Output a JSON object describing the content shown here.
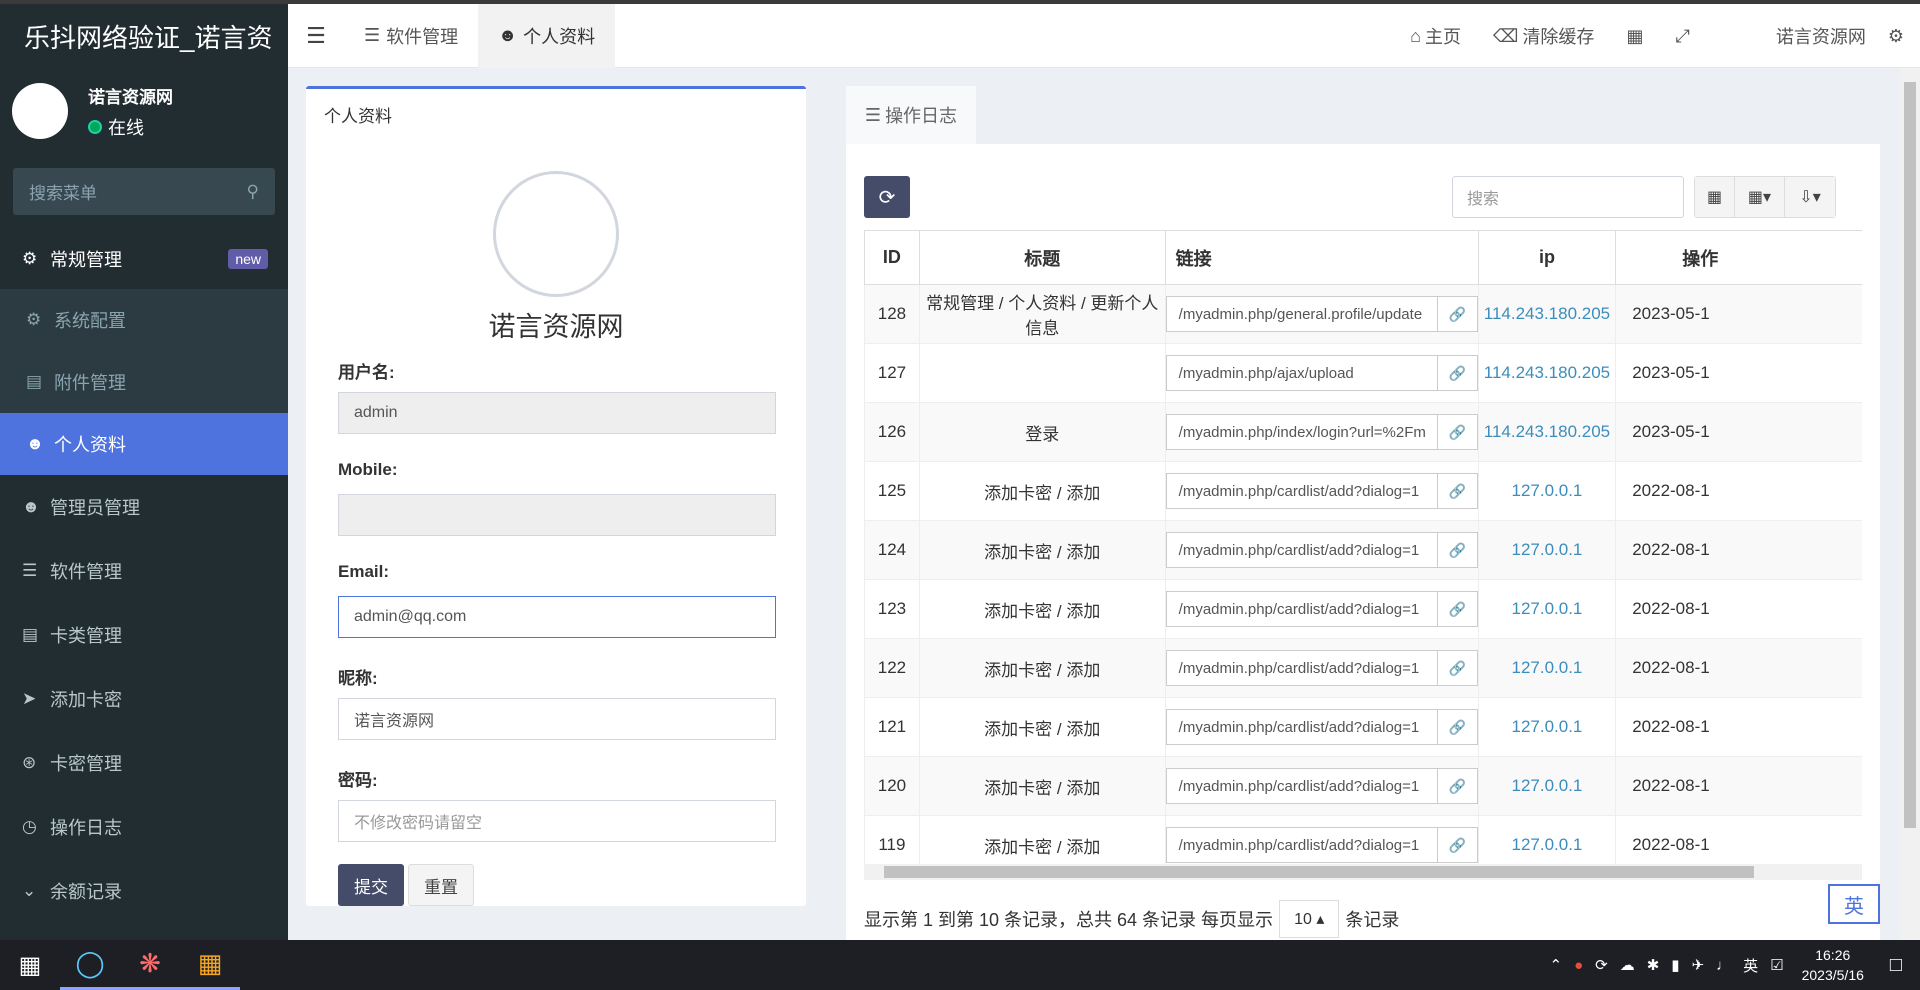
{
  "app": {
    "title": "乐抖网络验证_诺言资",
    "user_name": "诺言资源网",
    "status": "在线"
  },
  "sidebar": {
    "search_placeholder": "搜索菜单",
    "header": {
      "label": "常规管理",
      "badge": "new"
    },
    "submenu": [
      {
        "label": "系统配置",
        "icon": "gear-icon"
      },
      {
        "label": "附件管理",
        "icon": "file-image-icon"
      }
    ],
    "items": [
      {
        "label": "个人资料",
        "icon": "user-icon",
        "active": true
      },
      {
        "label": "管理员管理",
        "icon": "user-icon"
      },
      {
        "label": "软件管理",
        "icon": "list-icon"
      },
      {
        "label": "卡类管理",
        "icon": "tasks-icon"
      },
      {
        "label": "添加卡密",
        "icon": "paper-plane-icon"
      },
      {
        "label": "卡密管理",
        "icon": "rss-icon"
      },
      {
        "label": "操作日志",
        "icon": "clock-icon"
      },
      {
        "label": "余额记录",
        "icon": "chevron-down-icon"
      }
    ]
  },
  "navbar": {
    "tabs": [
      {
        "label": "软件管理",
        "icon": "list-icon"
      },
      {
        "label": "个人资料",
        "icon": "user-icon"
      }
    ],
    "home": "主页",
    "clear_cache": "清除缓存",
    "username": "诺言资源网"
  },
  "profile": {
    "panel_title": "个人资料",
    "display_name": "诺言资源网",
    "fields": {
      "username_label": "用户名:",
      "username_value": "admin",
      "mobile_label": "Mobile:",
      "mobile_value": "",
      "email_label": "Email:",
      "email_value": "admin@qq.com",
      "nickname_label": "昵称:",
      "nickname_value": "诺言资源网",
      "password_label": "密码:",
      "password_placeholder": "不修改密码请留空"
    },
    "submit": "提交",
    "reset": "重置"
  },
  "log": {
    "tab": "操作日志",
    "search_placeholder": "搜索",
    "columns": [
      "ID",
      "标题",
      "链接",
      "ip",
      "操作"
    ],
    "rows": [
      {
        "id": "128",
        "title": "常规管理 / 个人资料 / 更新个人信息",
        "url": "/myadmin.php/general.profile/update",
        "ip": "114.243.180.205",
        "time": "2023-05-1"
      },
      {
        "id": "127",
        "title": "",
        "url": "/myadmin.php/ajax/upload",
        "ip": "114.243.180.205",
        "time": "2023-05-1"
      },
      {
        "id": "126",
        "title": "登录",
        "url": "/myadmin.php/index/login?url=%2Fm",
        "ip": "114.243.180.205",
        "time": "2023-05-1"
      },
      {
        "id": "125",
        "title": "添加卡密 / 添加",
        "url": "/myadmin.php/cardlist/add?dialog=1",
        "ip": "127.0.0.1",
        "time": "2022-08-1"
      },
      {
        "id": "124",
        "title": "添加卡密 / 添加",
        "url": "/myadmin.php/cardlist/add?dialog=1",
        "ip": "127.0.0.1",
        "time": "2022-08-1"
      },
      {
        "id": "123",
        "title": "添加卡密 / 添加",
        "url": "/myadmin.php/cardlist/add?dialog=1",
        "ip": "127.0.0.1",
        "time": "2022-08-1"
      },
      {
        "id": "122",
        "title": "添加卡密 / 添加",
        "url": "/myadmin.php/cardlist/add?dialog=1",
        "ip": "127.0.0.1",
        "time": "2022-08-1"
      },
      {
        "id": "121",
        "title": "添加卡密 / 添加",
        "url": "/myadmin.php/cardlist/add?dialog=1",
        "ip": "127.0.0.1",
        "time": "2022-08-1"
      },
      {
        "id": "120",
        "title": "添加卡密 / 添加",
        "url": "/myadmin.php/cardlist/add?dialog=1",
        "ip": "127.0.0.1",
        "time": "2022-08-1"
      },
      {
        "id": "119",
        "title": "添加卡密 / 添加",
        "url": "/myadmin.php/cardlist/add?dialog=1",
        "ip": "127.0.0.1",
        "time": "2022-08-1"
      }
    ],
    "pager_prefix": "显示第 1 到第 10 条记录，总共 64 条记录 每页显示",
    "page_size": "10",
    "pager_suffix": "条记录"
  },
  "ime": "英",
  "taskbar": {
    "ime": "英",
    "time": "16:26",
    "date": "2023/5/16"
  },
  "colors": {
    "sidebar_bg": "#222d32",
    "accent": "#4e73df",
    "primary_button": "#444c69",
    "ip_link": "#3c8dbc"
  }
}
